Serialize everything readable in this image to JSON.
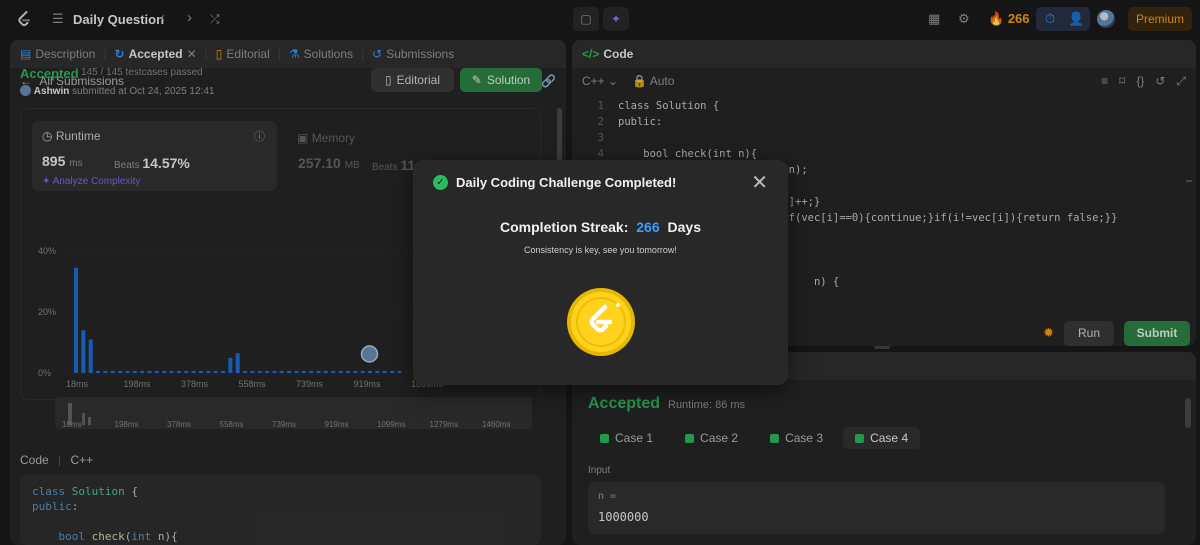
{
  "nav": {
    "title": "Daily Question",
    "streak_count": "266",
    "premium_label": "Premium"
  },
  "left_panel": {
    "tabs": [
      {
        "label": "Description"
      },
      {
        "label": "Accepted"
      },
      {
        "label": "Editorial"
      },
      {
        "label": "Solutions"
      },
      {
        "label": "Submissions"
      }
    ],
    "back_label": "All Submissions",
    "status": "Accepted",
    "testcases": "145 / 145 testcases passed",
    "submitter_name": "Ashwin",
    "submitted_at": "submitted at Oct 24, 2025 12:41",
    "editorial_button": "Editorial",
    "solution_button": "Solution",
    "runtime": {
      "label": "Runtime",
      "value": "895",
      "unit": "ms",
      "beats_label": "Beats",
      "beats_value": "14.57%",
      "analyze": "Analyze Complexity"
    },
    "memory": {
      "label": "Memory",
      "value": "257.10",
      "unit": "MB",
      "beats_label": "Beats",
      "beats_value": "11"
    },
    "code_label": "Code",
    "code_lang": "C++"
  },
  "chart_data": {
    "type": "bar",
    "ylabel": "",
    "xlabel": "",
    "yticks": [
      "40%",
      "20%",
      "0%"
    ],
    "ylim": [
      0,
      40
    ],
    "categories": [
      "18ms",
      "198ms",
      "378ms",
      "558ms",
      "739ms",
      "919ms",
      "1099ms"
    ],
    "bars": [
      34.5,
      14,
      11,
      0.7,
      0.7,
      0.7,
      0.7,
      0.7,
      0.7,
      0.7,
      0.7,
      0.7,
      0.7,
      0.7,
      0.7,
      0.7,
      0.7,
      0.7,
      0.7,
      0.7,
      0.7,
      5,
      6.5,
      0.7,
      0.7,
      0.7,
      0.7,
      0.7,
      0.7,
      0.7,
      0.7,
      0.7,
      0.7,
      0.7,
      0.7,
      0.7,
      0.7,
      0.7,
      0.7,
      0.7,
      0.7,
      0.7,
      0.7,
      0.7,
      0.7
    ],
    "bar_color": "#1e6fd9",
    "highlight_label": "919ms",
    "mini_ticks": [
      "18ms",
      "198ms",
      "378ms",
      "558ms",
      "739ms",
      "919ms",
      "1099ms",
      "1279ms",
      "1460ms"
    ]
  },
  "code_panel": {
    "title": "Code",
    "language": "C++",
    "mode": "Auto",
    "lines": [
      "class Solution {",
      "public:",
      "",
      "    bool check(int n){",
      "        string s=to_string(n);",
      "",
      "                           ]++;}",
      "                          if(vec[i]==0){continue;}if(i!=vec[i]){return false;}}",
      "",
      "",
      "",
      "                               n) {",
      "",
      ""
    ],
    "run_label": "Run",
    "submit_label": "Submit"
  },
  "result_panel": {
    "status": "Accepted",
    "runtime": "Runtime: 86 ms",
    "cases": [
      "Case 1",
      "Case 2",
      "Case 3",
      "Case 4"
    ],
    "input_label": "Input",
    "input_var": "n =",
    "input_value": "1000000"
  },
  "modal": {
    "title": "Daily Coding Challenge Completed!",
    "streak_prefix": "Completion Streak:",
    "streak_value": "266",
    "streak_suffix": "Days",
    "subtitle": "Consistency is key, see you tomorrow!"
  },
  "colors": {
    "accent_green": "#2cbb5d",
    "brand_orange": "#ffa116",
    "link_blue": "#3b9dff"
  }
}
